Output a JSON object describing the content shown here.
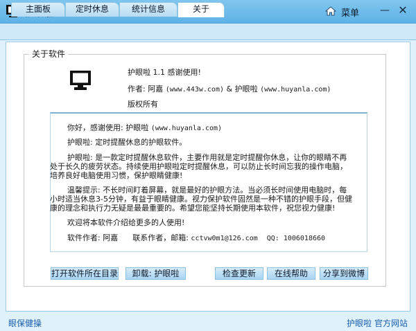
{
  "window": {
    "title": "护眼啦 1.1",
    "menu_label": "菜单",
    "minimize_glyph": "—",
    "close_glyph": "✕"
  },
  "tabs": [
    {
      "label": "主面板",
      "active": false
    },
    {
      "label": "定时休息",
      "active": false
    },
    {
      "label": "统计信息",
      "active": false
    },
    {
      "label": "关于",
      "active": true
    }
  ],
  "about": {
    "group_title": "关于软件",
    "line1": "护眼啦 1.1 感谢使用!",
    "author_prefix": "作者: 阿嘉",
    "author_site1": "(www.443w.com)",
    "author_and": "& 护眼啦",
    "author_site2": "(www.huyanla.com)",
    "copyright": "版权所有"
  },
  "content": {
    "hello_prefix": "你好，感谢使用: 护眼啦",
    "hello_site": "(www.huyanla.com)",
    "desc1": "护眼啦: 定时提醒休息的护眼软件。",
    "desc2_l1": "护眼啦: 是一款定时提醒休息软件，主要作用就是定时提醒你休息，让你的眼睛不再",
    "desc2_l2": "处于长久的疲劳状态。持续使用护眼啦定时提醒休息，可以防止长时间忘我的操作电脑，",
    "desc2_l3": "培养良好电脑使用习惯，保护眼睛健康!",
    "tip_l1": "温馨提示: 不长时间盯着屏幕，就是最好的护眼方法。当必须长时间使用电脑时，每",
    "tip_l2": "小时适当休息3-5分钟，有益于眼睛健康。视力保护软件固然是一种不错的护眼手段，但健",
    "tip_l3": "康的理念和执行力无疑是最最重要的。希望您能坚持长期使用本软件，祝您视力健康!",
    "welcome": "欢迎将本软件介绍给更多的人使用!",
    "author_label": "软件作者: 阿嘉",
    "contact_label": "联系作者，邮箱:",
    "email": "cctvw0m1@126.com",
    "qq": "QQ: 1006018660"
  },
  "buttons": {
    "open_dir": "打开软件所在目录",
    "uninstall": "卸载: 护眼啦",
    "update": "检查更新",
    "help": "在线帮助",
    "share": "分享到微博"
  },
  "footer": {
    "left": "眼保健操",
    "link1": "护眼啦",
    "link2": "官方网站"
  },
  "colors": {
    "titlebar": "#6fbdea",
    "link": "#1a5fb0",
    "background": "#dff1fb"
  }
}
